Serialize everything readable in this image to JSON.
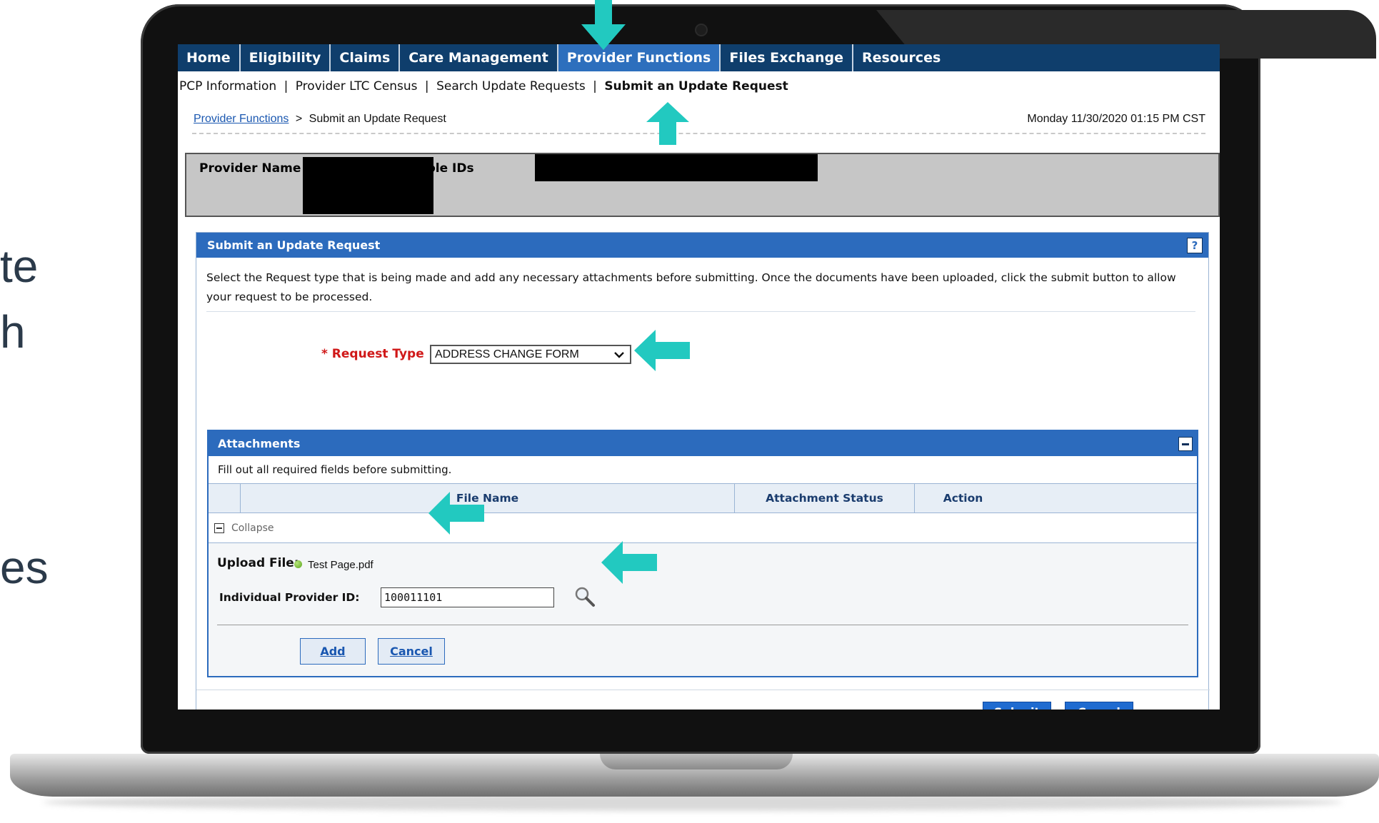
{
  "slide_fragments": [
    "te",
    "h",
    "es"
  ],
  "topnav": {
    "items": [
      "Home",
      "Eligibility",
      "Claims",
      "Care Management",
      "Provider Functions",
      "Files Exchange",
      "Resources"
    ],
    "active_index": 4
  },
  "subnav": {
    "items": [
      "PCP Information",
      "Provider LTC Census",
      "Search Update Requests",
      "Submit an Update Request"
    ],
    "separator": "|"
  },
  "breadcrumb": {
    "link": "Provider Functions",
    "separator": ">",
    "current": "Submit an Update Request"
  },
  "datetime": "Monday 11/30/2020 01:15 PM CST",
  "provider": {
    "name_label": "Provider Name",
    "role_label": "Role IDs"
  },
  "panel": {
    "title": "Submit an Update Request",
    "help": "?",
    "description": "Select the Request type that is being made and add any necessary attachments before submitting. Once the documents have been uploaded, click the submit button to allow your request to be processed."
  },
  "request_type": {
    "label": "* Request Type",
    "selected": "ADDRESS CHANGE FORM"
  },
  "attachments": {
    "title": "Attachments",
    "note": "Fill out all required fields before submitting.",
    "columns": [
      "File Name",
      "Attachment Status",
      "Action"
    ],
    "collapse_label": "Collapse",
    "upload_label": "Upload File:",
    "file_name": "Test Page.pdf",
    "provider_id_label": "Individual Provider ID:",
    "provider_id_value": "100011101",
    "add_label": "Add",
    "cancel_label": "Cancel"
  },
  "footer": {
    "submit_label": "Submit",
    "cancel_label": "Cancel"
  },
  "colors": {
    "nav_bg": "#0f3e6c",
    "nav_active": "#2d6fbd",
    "panel_header": "#2c6bbd",
    "required_red": "#d01818",
    "arrow_teal": "#22c9c0"
  }
}
